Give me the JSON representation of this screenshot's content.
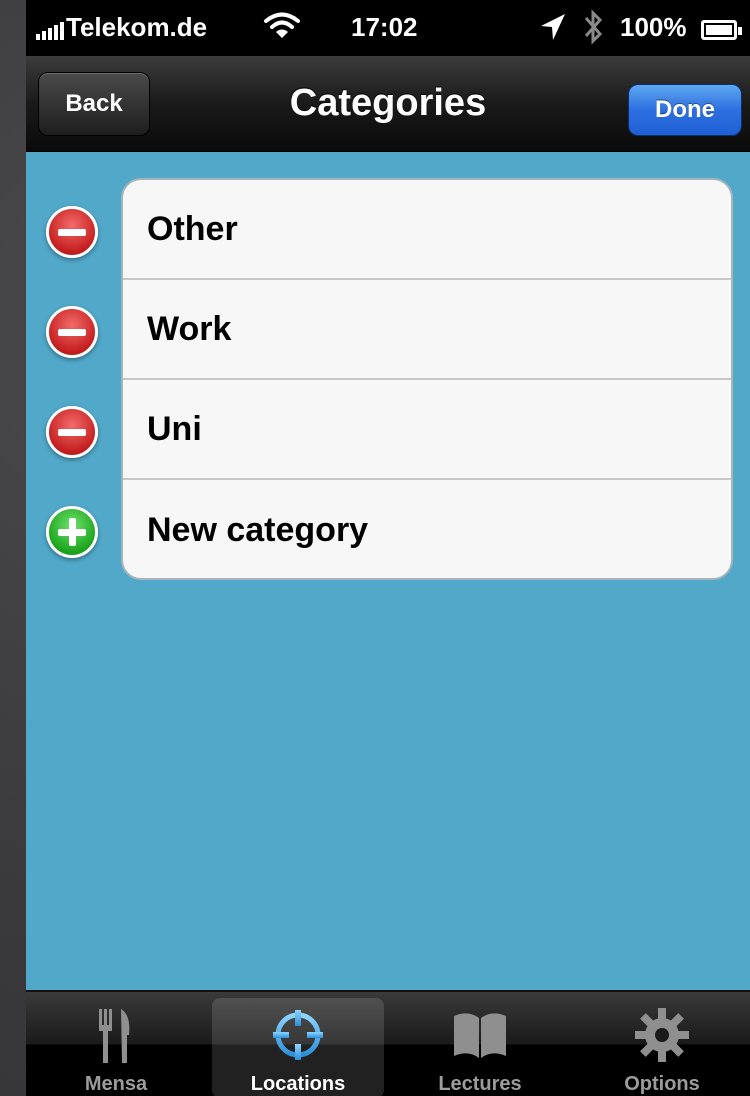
{
  "status_bar": {
    "carrier": "Telekom.de",
    "time": "17:02",
    "battery": "100%"
  },
  "nav": {
    "title": "Categories",
    "back_label": "Back",
    "done_label": "Done"
  },
  "categories": [
    {
      "label": "Other",
      "control": "delete"
    },
    {
      "label": "Work",
      "control": "delete"
    },
    {
      "label": "Uni",
      "control": "delete"
    },
    {
      "label": "New category",
      "control": "insert"
    }
  ],
  "tabs": [
    {
      "label": "Mensa",
      "icon": "fork-knife-icon",
      "selected": false
    },
    {
      "label": "Locations",
      "icon": "crosshair-icon",
      "selected": true
    },
    {
      "label": "Lectures",
      "icon": "book-icon",
      "selected": false
    },
    {
      "label": "Options",
      "icon": "gear-icon",
      "selected": false
    }
  ],
  "colors": {
    "background": "#51a8c8",
    "done_button": "#2d6fe0",
    "delete_control": "#c51f1f",
    "insert_control": "#1da51d"
  }
}
